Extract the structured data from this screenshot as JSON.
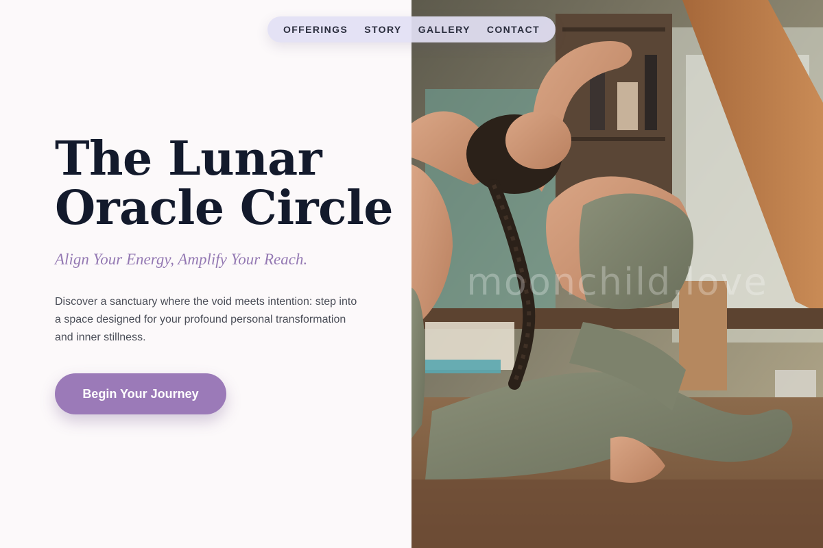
{
  "nav": {
    "items": [
      {
        "label": "OFFERINGS"
      },
      {
        "label": "STORY"
      },
      {
        "label": "GALLERY"
      },
      {
        "label": "CONTACT"
      }
    ]
  },
  "hero": {
    "title": "The Lunar Oracle Circle",
    "subtitle": "Align Your Energy, Amplify Your Reach.",
    "body": "Discover a sanctuary where the void meets intention: step into a space designed for your profound personal transformation and inner stillness.",
    "cta_label": "Begin Your Journey"
  },
  "photo": {
    "watermark": "moonchild.love"
  },
  "colors": {
    "background": "#fcf9fa",
    "title": "#131a2c",
    "accent": "#9b7ab8",
    "subtitle": "#9479b3",
    "nav_pill": "#e2e0f4"
  }
}
